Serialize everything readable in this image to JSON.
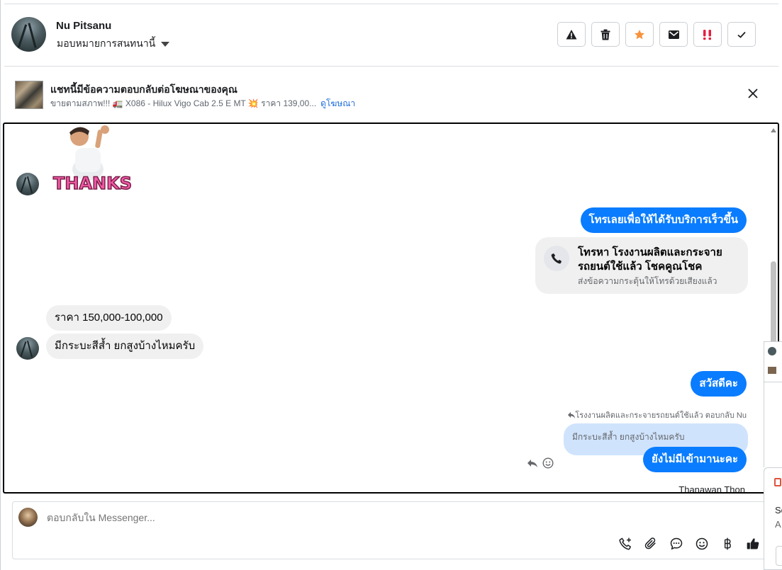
{
  "header": {
    "name": "Nu Pitsanu",
    "assign_label": "มอบหมายการสนทนานี้",
    "actions": [
      "report-icon",
      "trash-icon",
      "star-icon",
      "mail-icon",
      "urgent-icon",
      "check-icon"
    ]
  },
  "ad": {
    "title": "แชทนี้มีข้อความตอบกลับต่อโฆษณาของคุณ",
    "subtitle": "ขายตามสภาพ!!! 🚛 X086 - Hilux Vigo Cab 2.5 E MT 💥 ราคา 139,00...",
    "link": "ดูโฆษณา"
  },
  "chat": {
    "sticker_text": "THANKS!",
    "messages": {
      "out1": "โทรเลยเพื่อให้ได้รับบริการเร็วขึ้น",
      "call_title": "โทรหา โรงงานผลิตและกระจายรถยนต์ใช้แล้ว โชคคูณโชค",
      "call_sub": "ส่งข้อความกระตุ้นให้โทรด้วยเสียงแล้ว",
      "in1": "ราคา 150,000-100,000",
      "in2": "มีกระบะสีส้ำ ยกสูงบ้างไหมครับ",
      "out2": "สวัสดีคะ",
      "reply_meta": "โรงงานผลิตและกระจายรถยนต์ใช้แล้ว ตอบกลับ Nu",
      "quoted": "มีกระบะสีส้ำ ยกสูงบ้างไหมครับ",
      "out3": "ยังไม่มีเข้ามานะคะ",
      "sender": "Thanawan Thon"
    }
  },
  "composer": {
    "placeholder": "ตอบกลับใน Messenger...",
    "tools": [
      "call-add-icon",
      "attachment-icon",
      "quick-reply-icon",
      "emoji-icon",
      "baht-icon",
      "like-icon"
    ]
  },
  "side_panel": {
    "line1": "Sc",
    "line2": "A"
  },
  "colors": {
    "accent": "#0a7cff",
    "incoming_bubble": "#f0f0f0",
    "quoted_bubble": "#cfe3fc",
    "link": "#216fdb"
  }
}
